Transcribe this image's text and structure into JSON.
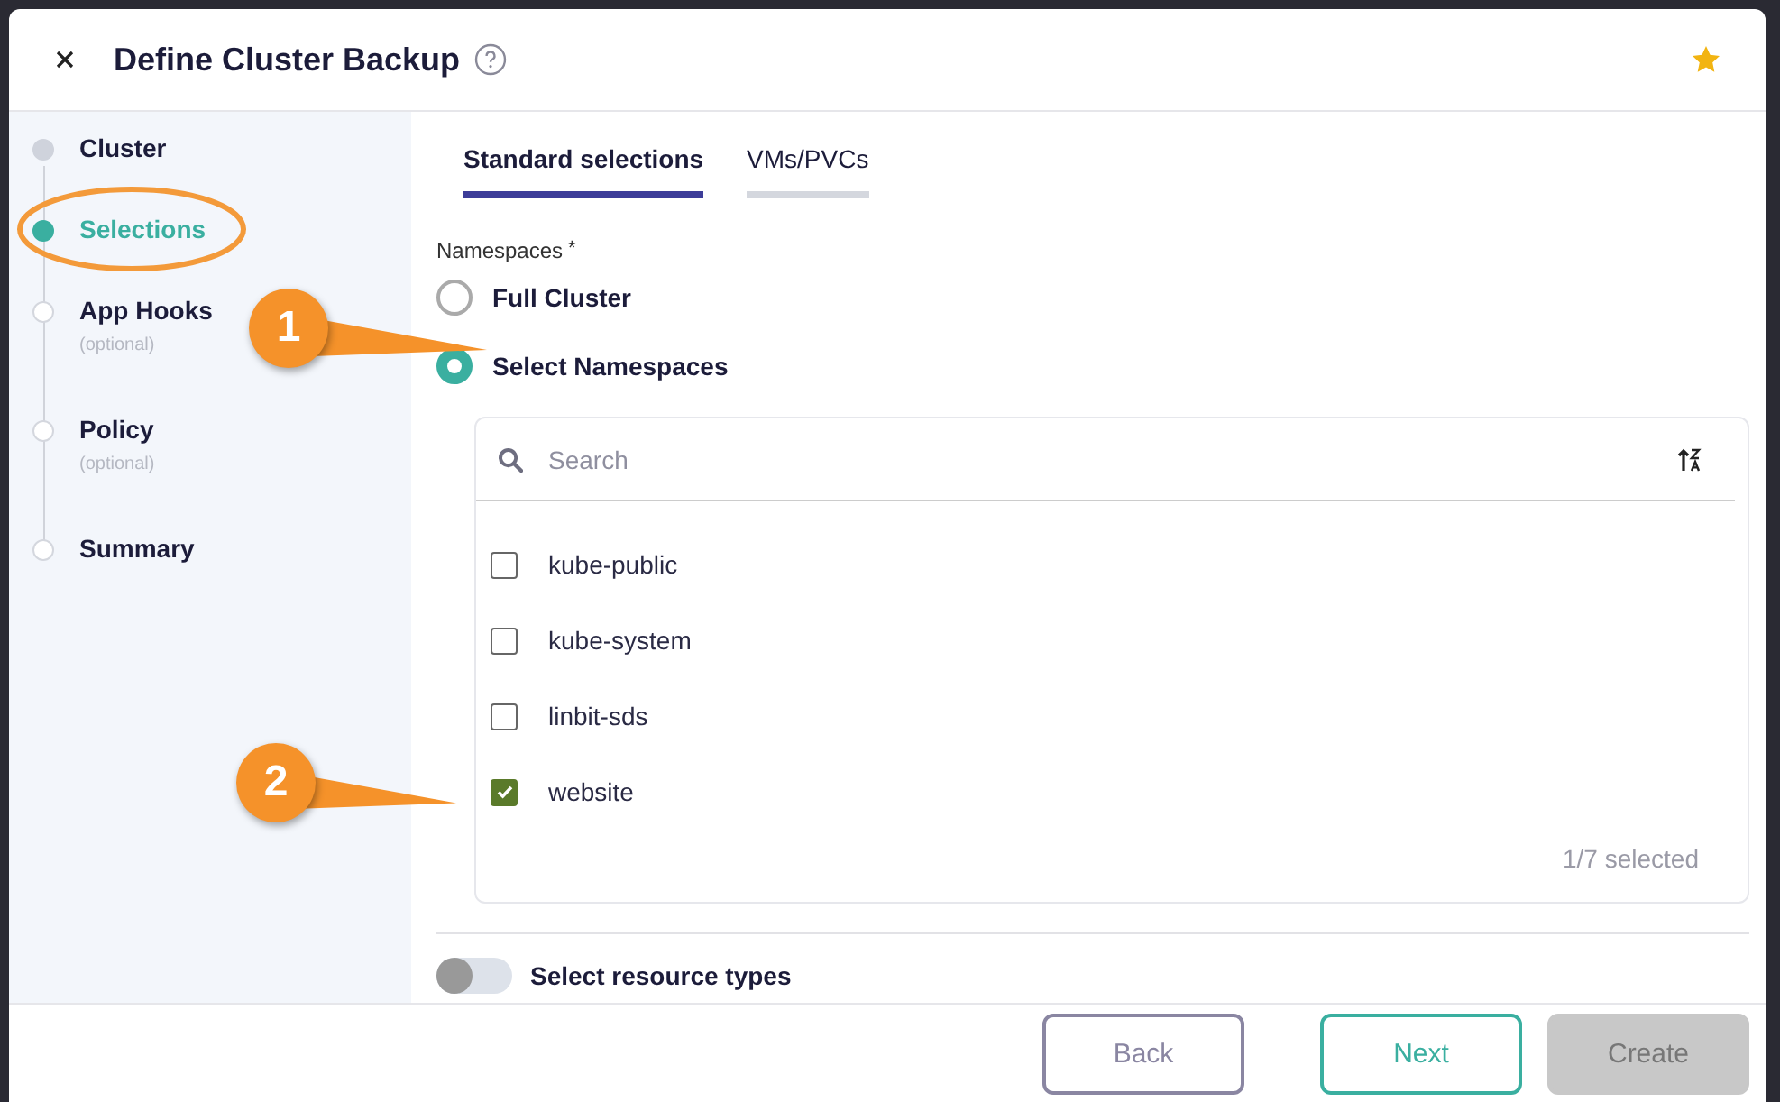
{
  "dialog": {
    "title": "Define Cluster Backup",
    "favorite": true
  },
  "steps": [
    {
      "label": "Cluster",
      "completed": true,
      "selected": false
    },
    {
      "label": "Selections",
      "completed": false,
      "selected": true
    },
    {
      "label": "App Hooks",
      "hint": "(optional)",
      "completed": false,
      "selected": false
    },
    {
      "label": "Policy",
      "hint": "(optional)",
      "completed": false,
      "selected": false
    },
    {
      "label": "Summary",
      "completed": false,
      "selected": false
    }
  ],
  "tabs": [
    {
      "label": "Standard selections",
      "selected": true
    },
    {
      "label": "VMs/PVCs",
      "selected": false
    }
  ],
  "namespaces": {
    "label": "Namespaces",
    "required_mark": "*",
    "options": [
      {
        "label": "Full Cluster",
        "selected": false
      },
      {
        "label": "Select Namespaces",
        "selected": true
      }
    ],
    "search": {
      "placeholder": "Search"
    },
    "items": [
      {
        "name": "kube-public",
        "checked": false
      },
      {
        "name": "kube-system",
        "checked": false
      },
      {
        "name": "linbit-sds",
        "checked": false
      },
      {
        "name": "website",
        "checked": true
      }
    ],
    "count": "1/7 selected"
  },
  "resource_types": {
    "label": "Select resource types",
    "on": false
  },
  "buttons": [
    {
      "label": "Back",
      "kind": "back"
    },
    {
      "label": "Next",
      "kind": "next"
    },
    {
      "label": "Create",
      "kind": "create",
      "disabled": true
    }
  ],
  "callouts": [
    {
      "number": "1"
    },
    {
      "number": "2"
    }
  ]
}
